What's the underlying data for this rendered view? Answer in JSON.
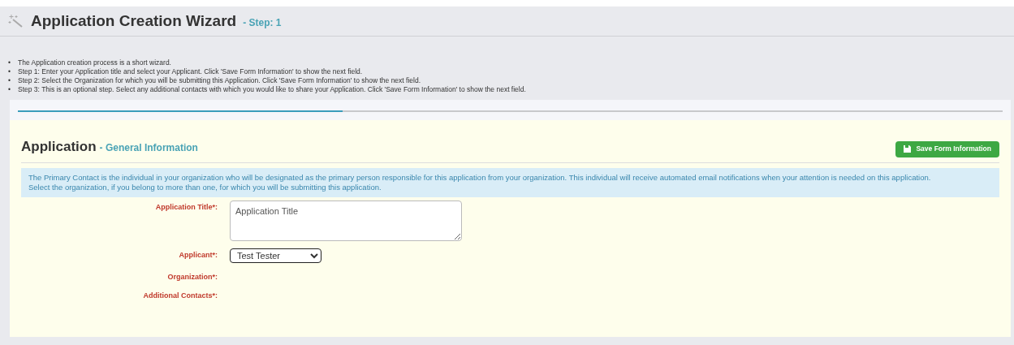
{
  "header": {
    "title": "Application Creation Wizard",
    "step": "- Step: 1"
  },
  "instructions": [
    {
      "marker": "•",
      "text": "The Application creation process is a short wizard."
    },
    {
      "marker": "•",
      "text": "Step 1: Enter your Application title and select your Applicant. Click 'Save Form Information' to show the next field."
    },
    {
      "marker": "•",
      "text": "Step 2: Select the Organization for which you will be submitting this Application. Click 'Save Form Information' to show the next field."
    },
    {
      "marker": "•",
      "text": "Step 3: This is an optional step. Select any additional contacts with which you would like to share your Application. Click 'Save Form Information' to show the next field."
    }
  ],
  "progress": {
    "level": 0.33
  },
  "section": {
    "title": "Application",
    "subtitle": "- General Information",
    "save_button": "Save Form Information"
  },
  "info": [
    "The Primary Contact is the individual in your organization who will be designated as the primary person responsible for this application from your organization. This individual will receive automated email notifications when your attention is needed on this application.",
    "Select the organization, if you belong to more than one, for which you will be submitting this application."
  ],
  "fields": [
    {
      "label": "Application Title*:",
      "kind": "textarea",
      "value": "Application Title"
    },
    {
      "label": "Applicant*:",
      "kind": "select",
      "value": "Test Tester"
    },
    {
      "label": "Organization*:",
      "kind": "empty"
    },
    {
      "label": "Additional Contacts*:",
      "kind": "empty"
    }
  ]
}
